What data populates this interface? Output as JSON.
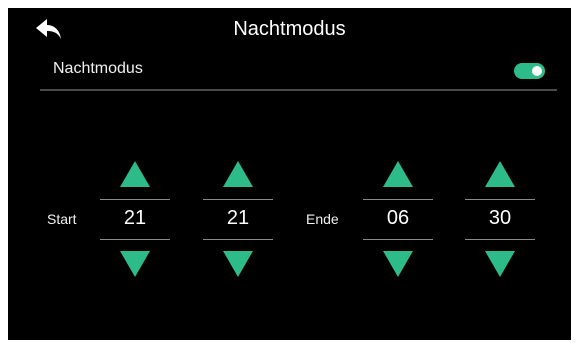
{
  "header": {
    "back_icon": "back-arrow-icon",
    "title": "Nachtmodus"
  },
  "setting": {
    "label": "Nachtmodus",
    "toggle_on": true
  },
  "colors": {
    "accent": "#2dbb8a",
    "background": "#000000"
  },
  "time": {
    "start_label": "Start",
    "end_label": "Ende",
    "start_hour": "21",
    "start_minute": "21",
    "end_hour": "06",
    "end_minute": "30"
  }
}
